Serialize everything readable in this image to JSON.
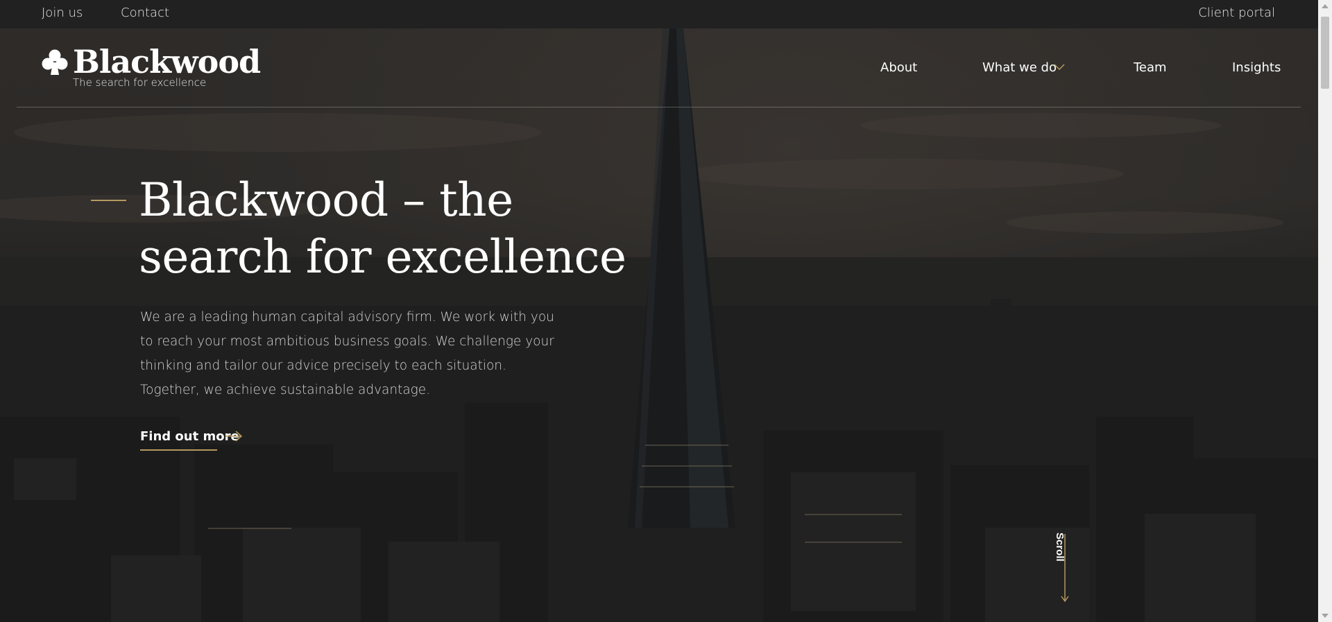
{
  "topbar": {
    "join_label": "Join us",
    "contact_label": "Contact",
    "portal_label": "Client portal"
  },
  "logo": {
    "name": "Blackwood",
    "tagline": "The search for excellence",
    "icon": "club-suit-icon"
  },
  "nav": {
    "items": [
      {
        "label": "About"
      },
      {
        "label": "What we do",
        "has_dropdown": true
      },
      {
        "label": "Team"
      },
      {
        "label": "Insights"
      }
    ]
  },
  "hero": {
    "headline": "Blackwood – the search for excellence",
    "intro": "We are a leading human capital advisory firm. We work with you to reach your most ambitious business goals. We challenge your thinking and tailor our advice precisely to each situation. Together, we achieve sustainable advantage.",
    "cta_label": "Find out more",
    "scroll_label": "Scroll"
  },
  "colors": {
    "accent_gold": "#b49a5e",
    "topbar_bg": "#212121",
    "text_muted": "#d4d4d4"
  }
}
